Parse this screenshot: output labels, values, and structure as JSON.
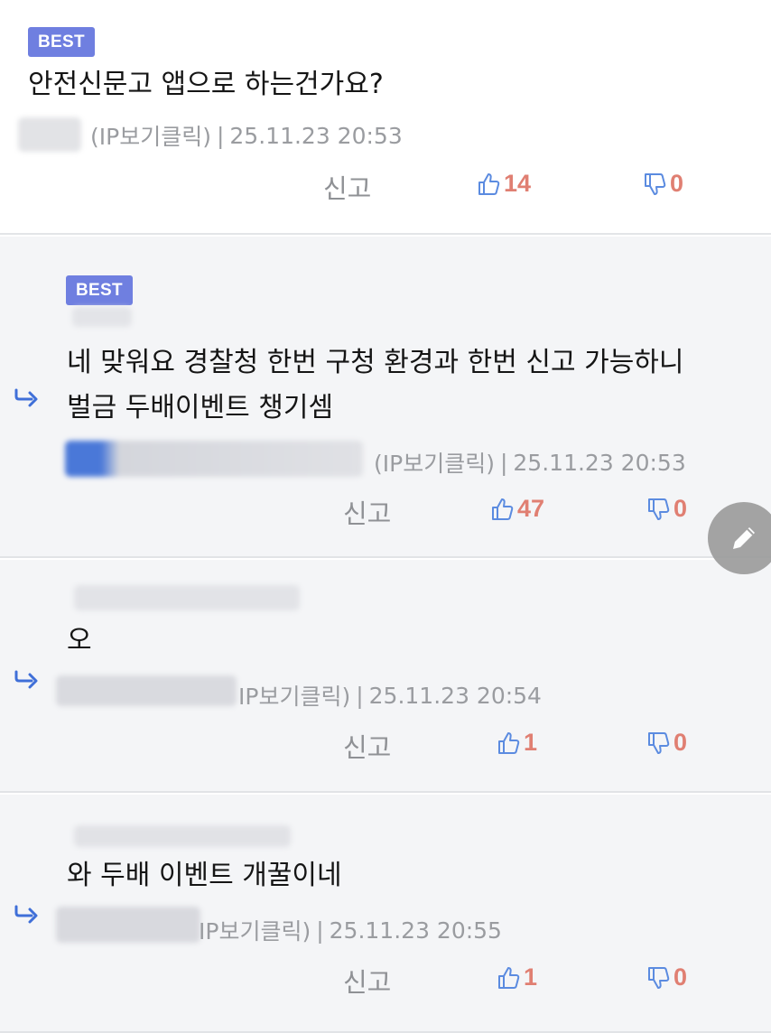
{
  "comments": [
    {
      "best_label": "BEST",
      "text": "안전신문고 앱으로 하는건가요?",
      "ip_label": "(IP보기클릭)",
      "separator": "|",
      "date": "25.11.23 20:53",
      "report_label": "신고",
      "likes": "14",
      "dislikes": "0"
    },
    {
      "best_label": "BEST",
      "text_line1": "네 맞워요 경찰청 한번 구청 환경과 한번 신고 가능하니",
      "text_line2": "벌금 두배이벤트 챙기셈",
      "ip_label": "(IP보기클릭)",
      "separator": "|",
      "date": "25.11.23 20:53",
      "report_label": "신고",
      "likes": "47",
      "dislikes": "0"
    },
    {
      "text": "오",
      "ip_label": "IP보기클릭)",
      "separator": "|",
      "date": "25.11.23 20:54",
      "report_label": "신고",
      "likes": "1",
      "dislikes": "0"
    },
    {
      "text": "와 두배 이벤트 개꿀이네",
      "ip_label": "IP보기클릭)",
      "separator": "|",
      "date": "25.11.23 20:55",
      "report_label": "신고",
      "likes": "1",
      "dislikes": "0"
    }
  ],
  "colors": {
    "best_badge": "#6f7fe0",
    "reply_arrow": "#3f6fd8",
    "like_icon": "#5b8be0",
    "count": "#e07f72"
  },
  "icons": {
    "reply": "reply-arrow-icon",
    "like": "thumbs-up-icon",
    "dislike": "thumbs-down-icon",
    "write": "pencil-icon"
  }
}
